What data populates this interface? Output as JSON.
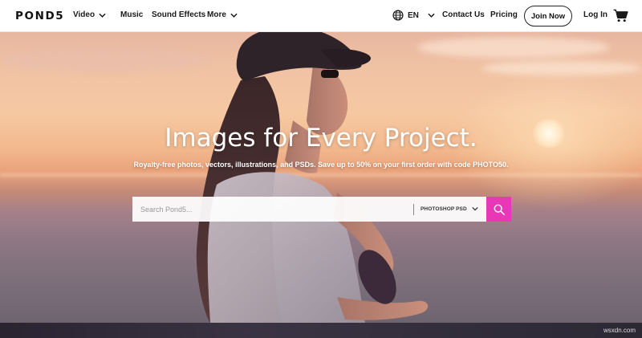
{
  "nav": {
    "logo": "POND5",
    "items": [
      {
        "label": "Video",
        "has_dropdown": true
      },
      {
        "label": "Music",
        "has_dropdown": false
      },
      {
        "label": "Sound Effects",
        "has_dropdown": false
      },
      {
        "label": "More",
        "has_dropdown": true
      }
    ],
    "language": "EN",
    "contact": "Contact Us",
    "pricing": "Pricing",
    "join": "Join Now",
    "login": "Log In",
    "icons": {
      "language": "globe-icon",
      "cart": "cart-icon",
      "chevron": "chevron-down-icon"
    }
  },
  "hero": {
    "title": "Images for Every Project.",
    "subtitle": "Royalty-free photos, vectors, illustrations, and PSDs. Save up to 50% on your first order with code PHOTO50.",
    "search": {
      "placeholder": "Search Pond5...",
      "value": "",
      "category": "PHOTOSHOP PSD",
      "button_icon": "search-icon"
    }
  },
  "watermark": "wsxdn.com",
  "colors": {
    "accent": "#e838b8",
    "text_dark": "#1a1a1a",
    "nav_bg": "#ffffff"
  }
}
